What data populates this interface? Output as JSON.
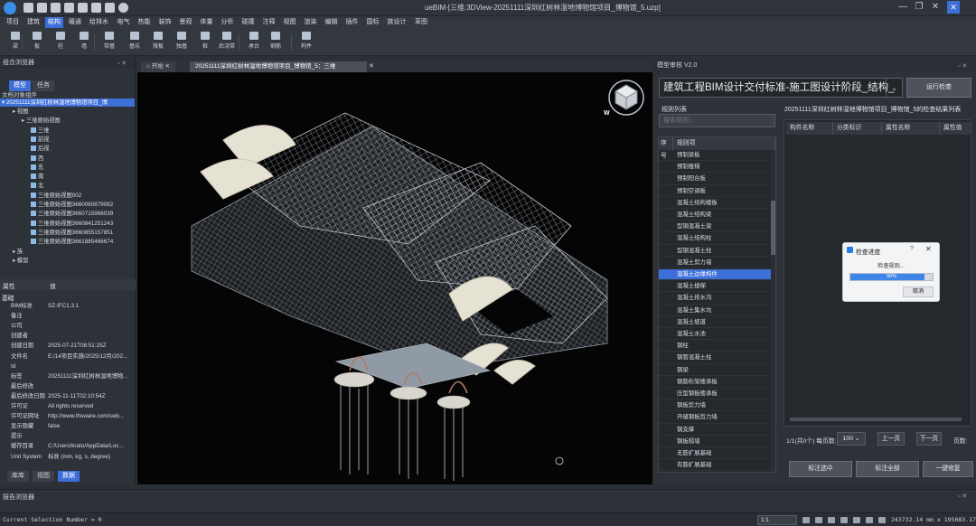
{
  "app": {
    "title": "ueBIM-[三维:3DView-20251111深圳红树林湿地博物馆项目_博物馆_5.uzp]"
  },
  "menu": [
    "项目",
    "建筑",
    "结构",
    "暖通",
    "给排水",
    "电气",
    "热能",
    "装饰",
    "景观",
    "体量",
    "分析",
    "碰撞",
    "注释",
    "视图",
    "渲染",
    "编辑",
    "插件",
    "国标",
    "族设计",
    "草图"
  ],
  "menu_active": "结构",
  "toolbar": [
    {
      "label": "梁",
      "icon": "beam-icon"
    },
    {
      "label": "板",
      "icon": "slab-icon"
    },
    {
      "label": "柱",
      "icon": "column-icon"
    },
    {
      "label": "墙",
      "icon": "wall-icon"
    },
    {
      "label": "带基",
      "icon": "strip-footing-icon"
    },
    {
      "label": "基坑",
      "icon": "foundation-pit-icon"
    },
    {
      "label": "筏板",
      "icon": "raft-icon"
    },
    {
      "label": "独基",
      "icon": "isolated-footing-icon"
    },
    {
      "label": "桩",
      "icon": "pile-icon"
    },
    {
      "label": "后浇带",
      "icon": "post-cast-strip-icon"
    },
    {
      "label": "承台",
      "icon": "pile-cap-icon"
    },
    {
      "label": "钢筋",
      "icon": "rebar-icon"
    },
    {
      "label": "构件",
      "icon": "component-icon"
    }
  ],
  "left": {
    "title": "组合浏览器",
    "tabs": [
      "模型",
      "任务"
    ],
    "active_tab": "模型",
    "docs_label": "文档对象组件",
    "project": "20251111深圳红树林湿地博物馆项目_博",
    "tree": [
      {
        "label": "视图",
        "indent": 1
      },
      {
        "label": "三维原始视图",
        "indent": 2
      },
      {
        "label": "三维",
        "indent": 3
      },
      {
        "label": "前视",
        "indent": 3
      },
      {
        "label": "后视",
        "indent": 3
      },
      {
        "label": "西",
        "indent": 3
      },
      {
        "label": "东",
        "indent": 3
      },
      {
        "label": "南",
        "indent": 3
      },
      {
        "label": "北",
        "indent": 3
      },
      {
        "label": "三维原始视图002",
        "indent": 3
      },
      {
        "label": "三维原始视图3660060879082",
        "indent": 3
      },
      {
        "label": "三维原始视图3660715966039",
        "indent": 3
      },
      {
        "label": "三维原始视图3660841251243",
        "indent": 3
      },
      {
        "label": "三维原始视图3660855157851",
        "indent": 3
      },
      {
        "label": "三维原始视图3661885466674",
        "indent": 3
      },
      {
        "label": "族",
        "indent": 1
      },
      {
        "label": "模型",
        "indent": 1
      }
    ],
    "props_headers": [
      "属性",
      "值"
    ],
    "props_group": "基础",
    "props": [
      {
        "k": "BIM标准",
        "v": "SZ-IFC1.3.1"
      },
      {
        "k": "备注",
        "v": ""
      },
      {
        "k": "公司",
        "v": ""
      },
      {
        "k": "创建者",
        "v": ""
      },
      {
        "k": "创建日期",
        "v": "2025-07-21T08:51:25Z"
      },
      {
        "k": "文件名",
        "v": "E:/14项目实施/2025/12月/202..."
      },
      {
        "k": "Id",
        "v": ""
      },
      {
        "k": "标签",
        "v": "20251111深圳红树林湿地博物..."
      },
      {
        "k": "最后修改",
        "v": ""
      },
      {
        "k": "最后修改日期",
        "v": "2025-11-11T02:10:54Z"
      },
      {
        "k": "许可证",
        "v": "All rights reserved"
      },
      {
        "k": "许可证网址",
        "v": "http://www.thsware.com/ueb..."
      },
      {
        "k": "显示隐藏",
        "v": "false"
      },
      {
        "k": "提示",
        "v": ""
      },
      {
        "k": "缓存目录",
        "v": "C:/Users/krato/AppData/Loc..."
      },
      {
        "k": "Unit System",
        "v": "标准 (mm, kg, s, degree)"
      }
    ],
    "bottom_tabs": [
      "库库",
      "视图",
      "数据"
    ],
    "bottom_active": "数据"
  },
  "view_tabs": [
    {
      "label": "开始"
    },
    {
      "label": "20251111深圳红树林湿地博物馆项目_博物馆_5：三维"
    }
  ],
  "right": {
    "title": "模型审核 V2.0",
    "standard": "建筑工程BIM设计交付标准-施工图设计阶段_结构_",
    "run_button": "运行检查",
    "rule_list_label": "规则列表",
    "search_placeholder": "搜索规则...",
    "rule_headers": [
      "序号",
      "规则项"
    ],
    "rules": [
      "预制梁板",
      "预制楼梯",
      "预制阳台板",
      "预制空调板",
      "混凝土结构楼板",
      "混凝土结构梁",
      "型钢混凝土梁",
      "混凝土结构柱",
      "型钢混凝土柱",
      "混凝土剪力墙",
      "混凝土边缘构件",
      "混凝土楼梯",
      "混凝土排水沟",
      "混凝土集水坑",
      "混凝土坡道",
      "混凝土水池",
      "钢柱",
      "钢管混凝土柱",
      "钢梁",
      "钢筋桁架楼承板",
      "压型钢板楼承板",
      "钢板剪力墙",
      "开缝钢板剪力墙",
      "钢支撑",
      "钢板隔墙",
      "无筋扩展基础",
      "有筋扩展基础"
    ],
    "selected_rule": "混凝土边缘构件",
    "result_title": "20251111深圳红树林湿地博物馆项目_博物馆_5的检查结果列表",
    "result_headers": [
      "构件名称",
      "分类标识",
      "属性名称",
      "属性值"
    ],
    "pager": {
      "page_info": "1/1(共0个) 每页数:",
      "page_size": "100",
      "prev": "上一页",
      "next": "下一页",
      "page_num_label": "页数:"
    },
    "bottom_buttons": [
      "标注选中",
      "标注全部",
      "一键修复"
    ]
  },
  "dialog": {
    "title": "检查进度",
    "message": "检查规则...",
    "progress": 0.9,
    "progress_text": "90%",
    "cancel": "取消"
  },
  "report": {
    "title": "报告浏览器"
  },
  "status": {
    "selection": "Current Selection Number = 0",
    "zoom": "1:1",
    "coords": "243732.14 mm x 195083.17 mm"
  },
  "view_cube": {
    "label": "W"
  }
}
